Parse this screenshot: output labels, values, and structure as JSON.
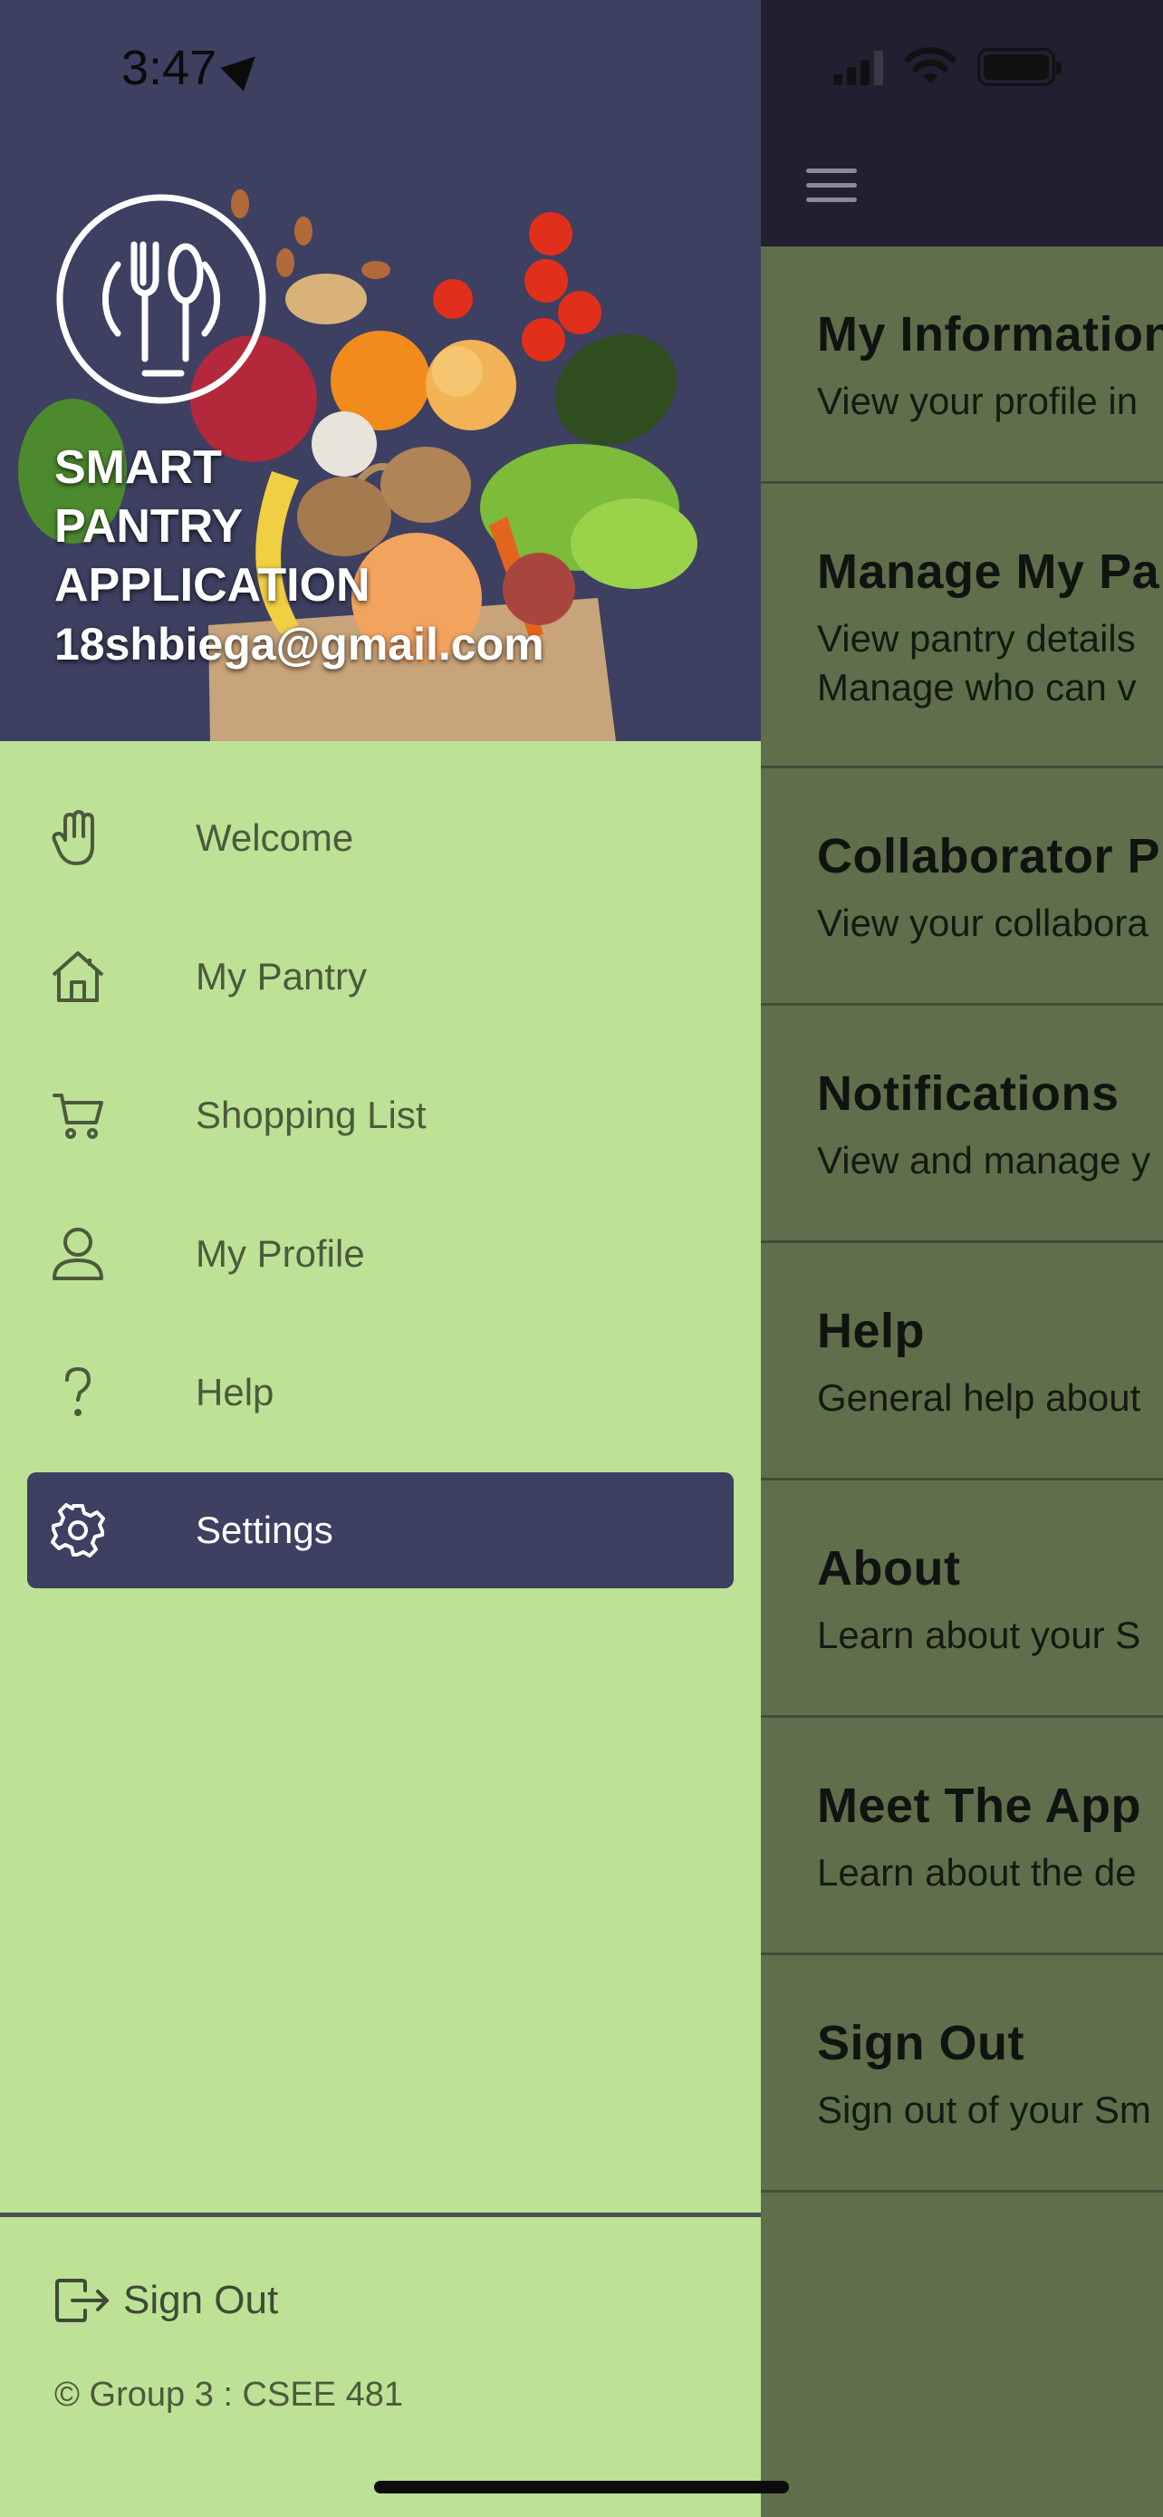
{
  "status_bar": {
    "time": "3:47"
  },
  "drawer": {
    "brand": {
      "line1": "SMART",
      "line2": "PANTRY",
      "line3": "APPLICATION",
      "email": "18shbiega@gmail.com"
    },
    "menu": [
      {
        "label": "Welcome",
        "icon": "hand-icon",
        "active": false
      },
      {
        "label": "My Pantry",
        "icon": "home-icon",
        "active": false
      },
      {
        "label": "Shopping List",
        "icon": "cart-icon",
        "active": false
      },
      {
        "label": "My Profile",
        "icon": "person-icon",
        "active": false
      },
      {
        "label": "Help",
        "icon": "question-icon",
        "active": false
      },
      {
        "label": "Settings",
        "icon": "gear-icon",
        "active": true
      }
    ],
    "signout_label": "Sign Out",
    "copyright": "© Group 3 : CSEE 481"
  },
  "settings_list": [
    {
      "title": "My Information",
      "desc": "View your profile in"
    },
    {
      "title": "Manage My Pa",
      "desc": "View pantry details",
      "desc2": "Manage who can v"
    },
    {
      "title": "Collaborator P",
      "desc": "View your collabora"
    },
    {
      "title": "Notifications",
      "desc": "View and manage y"
    },
    {
      "title": "Help",
      "desc": "General help about"
    },
    {
      "title": "About",
      "desc": "Learn about your S"
    },
    {
      "title": "Meet The App",
      "desc": "Learn about the de"
    },
    {
      "title": "Sign Out",
      "desc": "Sign out of your Sm"
    }
  ],
  "colors": {
    "drawer_bg": "#bde296",
    "header_bg": "#3d4060",
    "active_bg": "#3d4060",
    "overlay_bg": "#5f6f4b"
  }
}
